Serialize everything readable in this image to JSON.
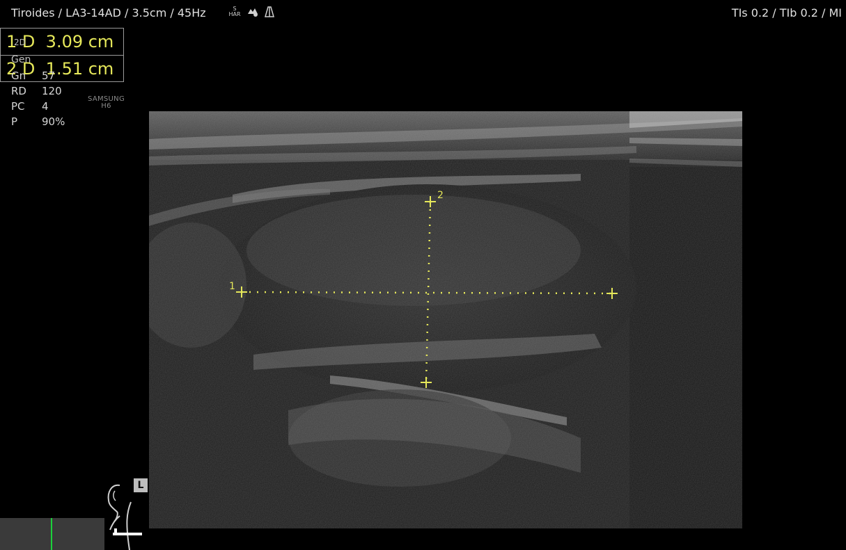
{
  "header": {
    "title": "Tiroides / LA3-14AD / 3.5cm / 45Hz",
    "har_top": "S",
    "har_bottom": "HAR",
    "indices": "TIs  0.2 / TIb  0.2 / MI"
  },
  "measurements": [
    {
      "index": "1",
      "label": "D",
      "value": "3.09 cm"
    },
    {
      "index": "2",
      "label": "D",
      "value": "1.51 cm"
    }
  ],
  "params": {
    "mode": "2D",
    "gen": "Gen",
    "items": [
      {
        "key": "Gn",
        "value": "57"
      },
      {
        "key": "RD",
        "value": "120"
      },
      {
        "key": "PC",
        "value": "4"
      },
      {
        "key": "P",
        "value": "90%"
      }
    ]
  },
  "brand": {
    "line1": "SAMSUNG",
    "line2": "H6"
  },
  "calipers": {
    "label_1": "1",
    "label_2": "2"
  },
  "orientation": {
    "badge": "L"
  },
  "colors": {
    "caliper": "#e6e85a",
    "marker": "#1bd13b"
  }
}
